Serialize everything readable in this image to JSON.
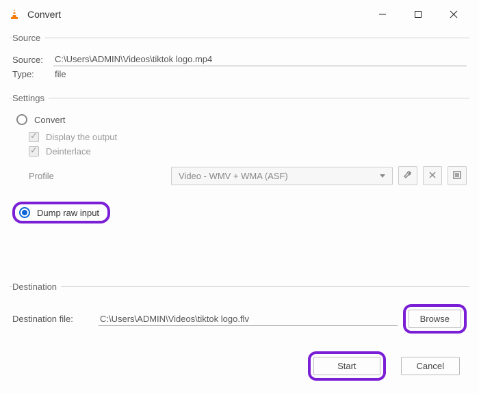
{
  "window": {
    "title": "Convert"
  },
  "source": {
    "legend": "Source",
    "source_label": "Source:",
    "source_value": "C:\\Users\\ADMIN\\Videos\\tiktok logo.mp4",
    "type_label": "Type:",
    "type_value": "file"
  },
  "settings": {
    "legend": "Settings",
    "convert_label": "Convert",
    "display_output_label": "Display the output",
    "deinterlace_label": "Deinterlace",
    "profile_label": "Profile",
    "profile_value": "Video - WMV + WMA (ASF)",
    "dump_raw_label": "Dump raw input"
  },
  "destination": {
    "legend": "Destination",
    "dest_label": "Destination file:",
    "dest_value": "C:\\Users\\ADMIN\\Videos\\tiktok logo.flv",
    "browse_label": "Browse"
  },
  "footer": {
    "start_label": "Start",
    "cancel_label": "Cancel"
  }
}
